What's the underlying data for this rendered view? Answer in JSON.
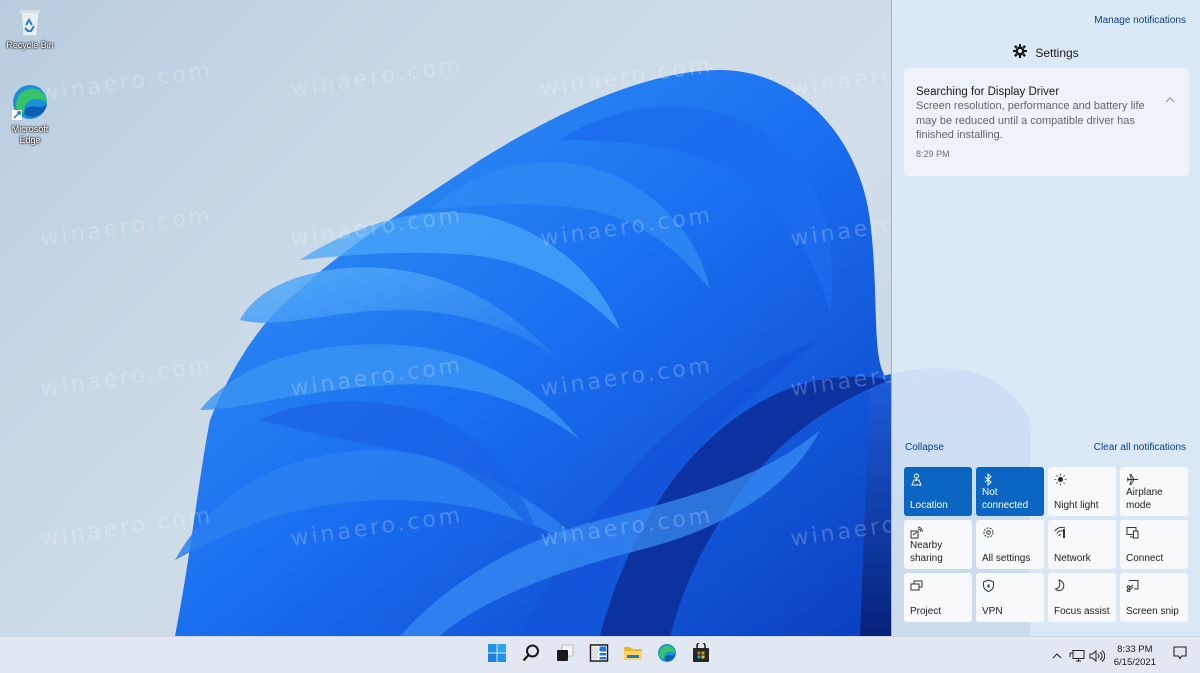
{
  "desktop": {
    "watermark_text": "winaero.com",
    "icons": [
      {
        "label": "Recycle Bin",
        "icon": "recycle-bin-icon"
      },
      {
        "label": "Microsoft Edge",
        "icon": "edge-icon"
      }
    ]
  },
  "action_center": {
    "manage_notifications": "Manage notifications",
    "app_group": {
      "name": "Settings",
      "icon": "gear-icon"
    },
    "notification": {
      "title": "Searching for Display Driver",
      "body": "Screen resolution, performance and battery life may be reduced until a compatible driver has finished installing.",
      "time": "8:29 PM",
      "collapse_icon": "chevron-up-icon"
    },
    "collapse": "Collapse",
    "clear_all": "Clear all notifications",
    "accent_color": "#0a66c2",
    "quick_actions": [
      {
        "label": "Location",
        "icon": "location-icon",
        "active": true
      },
      {
        "label": "Not connected",
        "icon": "bluetooth-icon",
        "active": true
      },
      {
        "label": "Night light",
        "icon": "night-light-icon",
        "active": false
      },
      {
        "label": "Airplane mode",
        "icon": "airplane-icon",
        "active": false
      },
      {
        "label": "Nearby sharing",
        "icon": "nearby-sharing-icon",
        "active": false
      },
      {
        "label": "All settings",
        "icon": "gear-icon",
        "active": false
      },
      {
        "label": "Network",
        "icon": "network-icon",
        "active": false
      },
      {
        "label": "Connect",
        "icon": "connect-icon",
        "active": false
      },
      {
        "label": "Project",
        "icon": "project-icon",
        "active": false
      },
      {
        "label": "VPN",
        "icon": "vpn-icon",
        "active": false
      },
      {
        "label": "Focus assist",
        "icon": "moon-icon",
        "active": false
      },
      {
        "label": "Screen snip",
        "icon": "screen-snip-icon",
        "active": false
      }
    ]
  },
  "taskbar": {
    "apps": [
      {
        "name": "Start",
        "icon": "windows-start-icon"
      },
      {
        "name": "Search",
        "icon": "search-icon"
      },
      {
        "name": "Task View",
        "icon": "task-view-icon"
      },
      {
        "name": "Widgets",
        "icon": "widgets-icon"
      },
      {
        "name": "File Explorer",
        "icon": "folder-icon"
      },
      {
        "name": "Microsoft Edge",
        "icon": "edge-icon"
      },
      {
        "name": "Microsoft Store",
        "icon": "store-icon"
      }
    ],
    "tray": {
      "time": "8:33 PM",
      "date": "6/15/2021"
    }
  }
}
